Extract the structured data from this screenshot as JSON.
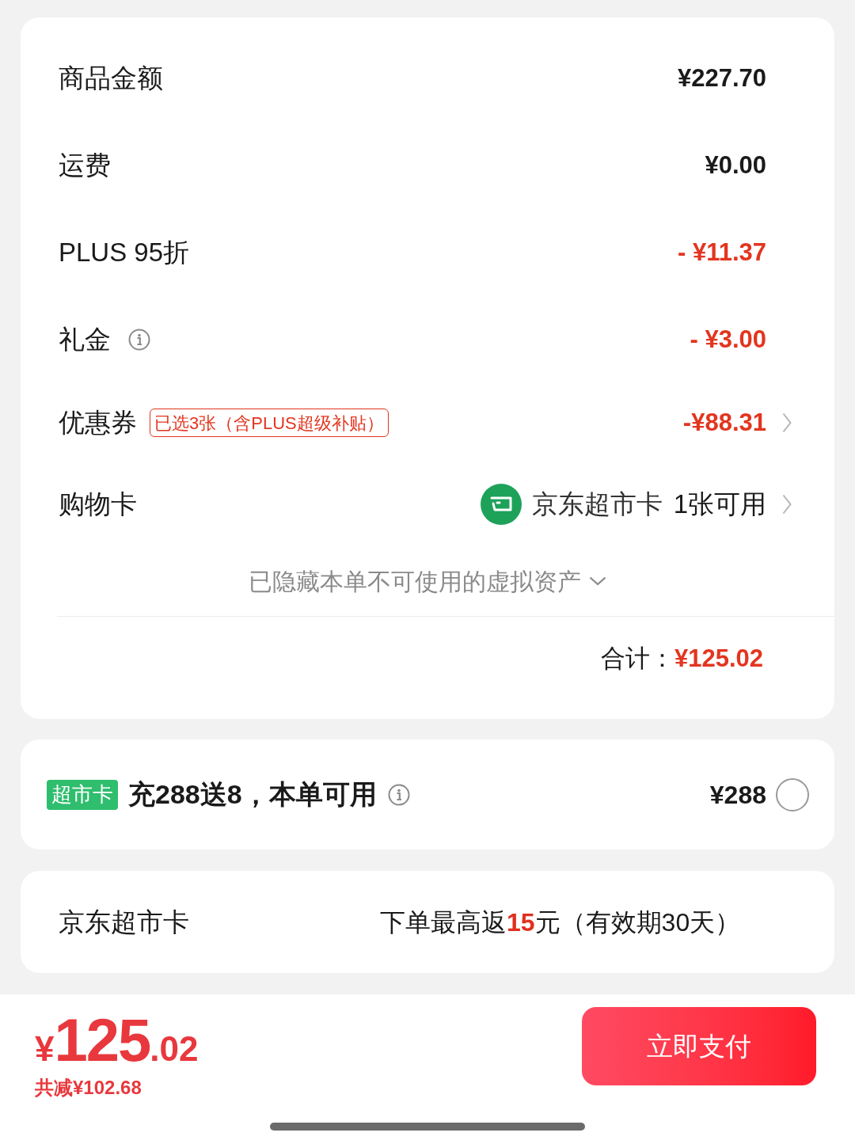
{
  "summary": {
    "rows": [
      {
        "kind": "amount",
        "label": "商品金额",
        "value": "¥227.70"
      },
      {
        "kind": "amount",
        "label": "运费",
        "value": "¥0.00"
      },
      {
        "kind": "discount",
        "label": "PLUS 95折",
        "value": "- ¥11.37"
      },
      {
        "kind": "discount",
        "label": "礼金",
        "info": true,
        "value": "- ¥3.00"
      },
      {
        "kind": "coupon",
        "label": "优惠券",
        "tag": "已选3张（含PLUS超级补贴）",
        "value": "-¥88.31"
      },
      {
        "kind": "card",
        "label": "购物卡",
        "card_name": "京东超市卡",
        "availability": "1张可用"
      }
    ],
    "hidden_notice": "已隐藏本单不可使用的虚拟资产",
    "total": {
      "label": "合计：",
      "value": "¥125.02"
    }
  },
  "recharge_offer": {
    "badge": "超市卡",
    "text": "充288送8，本单可用",
    "info": true,
    "price": "¥288",
    "selected": false
  },
  "cashback": {
    "label": "京东超市卡",
    "text_before": "下单最高返",
    "highlight": "15",
    "text_after": "元（有效期30天）"
  },
  "checkout_bar": {
    "currency": "¥",
    "amount_integer": "125",
    "amount_fraction": ".02",
    "savings": "共减¥102.68",
    "pay_button": "立即支付"
  }
}
